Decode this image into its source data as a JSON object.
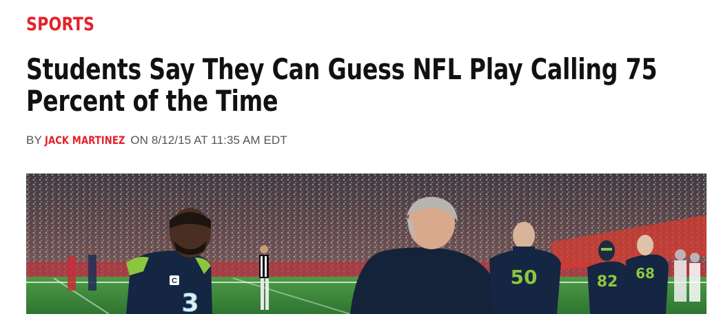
{
  "article": {
    "section": "SPORTS",
    "headline": "Students Say They Can Guess NFL Play Calling 75 Percent of the Time",
    "byline": {
      "prefix": "BY",
      "author": "JACK MARTINEZ",
      "connector": "ON",
      "date": "8/12/15 AT 11:35 AM EDT"
    }
  },
  "hero_image": {
    "jersey_numbers": [
      "3",
      "50",
      "82",
      "68"
    ],
    "colors": {
      "navy": "#142641",
      "field_green": "#3d8a3a",
      "accent_red": "#e4222a",
      "seahawks_lime": "#8cc63f"
    }
  }
}
